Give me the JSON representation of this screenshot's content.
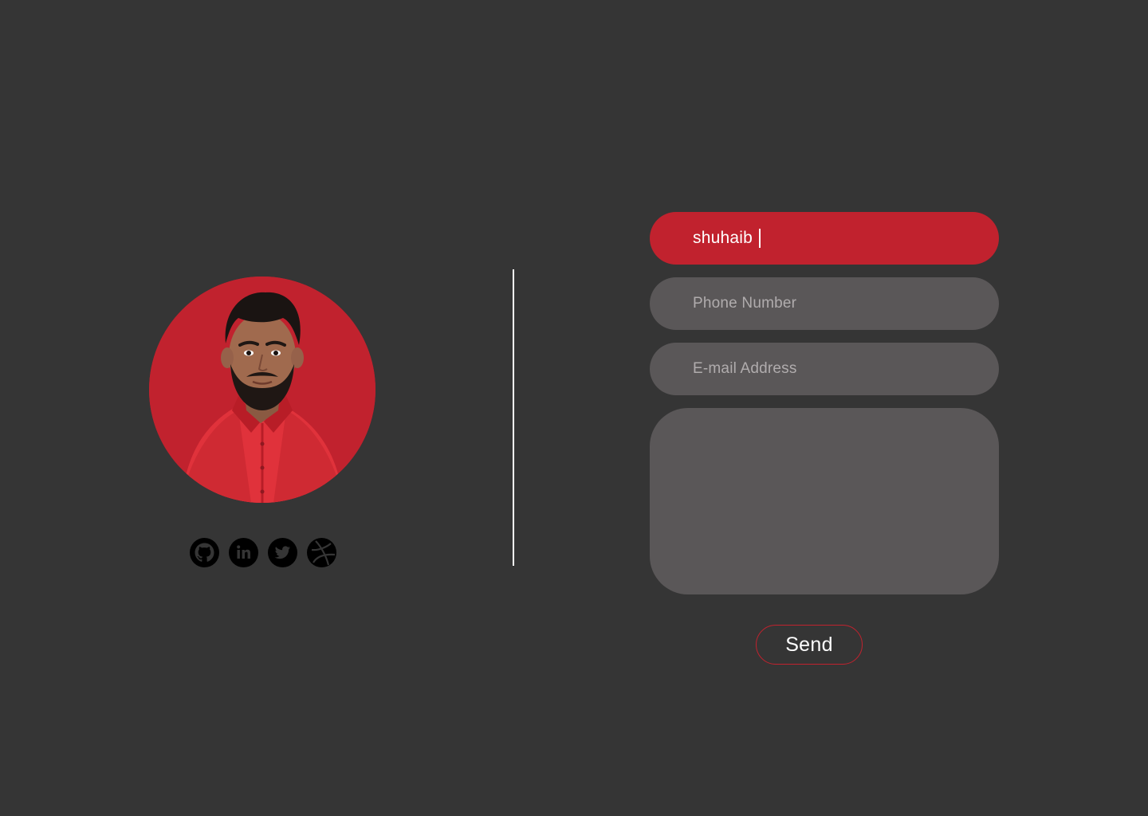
{
  "profile": {
    "avatar_icon": "person-portrait-icon",
    "accent_color": "#c1222e"
  },
  "socials": [
    {
      "name": "github",
      "icon": "github-icon"
    },
    {
      "name": "linkedin",
      "icon": "linkedin-icon"
    },
    {
      "name": "twitter",
      "icon": "twitter-icon"
    },
    {
      "name": "dribbble",
      "icon": "dribbble-icon"
    }
  ],
  "form": {
    "name_value": "shuhaib",
    "phone_placeholder": "Phone Number",
    "email_placeholder": "E-mail Address",
    "message_value": "",
    "send_label": "Send"
  },
  "colors": {
    "background": "#353535",
    "field_background": "#5a5758",
    "accent": "#c1222e",
    "placeholder_text": "#b0acad",
    "text": "#ffffff"
  }
}
